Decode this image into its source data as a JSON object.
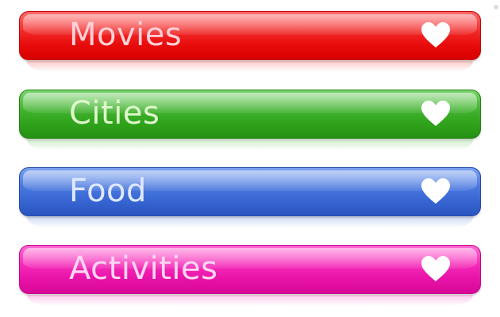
{
  "buttons": [
    {
      "label": "Movies",
      "icon": "heart-icon",
      "color": "#e80b0b"
    },
    {
      "label": "Cities",
      "icon": "heart-icon",
      "color": "#2fa31b"
    },
    {
      "label": "Food",
      "icon": "heart-icon",
      "color": "#3665d2"
    },
    {
      "label": "Activities",
      "icon": "heart-icon",
      "color": "#e812a8"
    }
  ]
}
